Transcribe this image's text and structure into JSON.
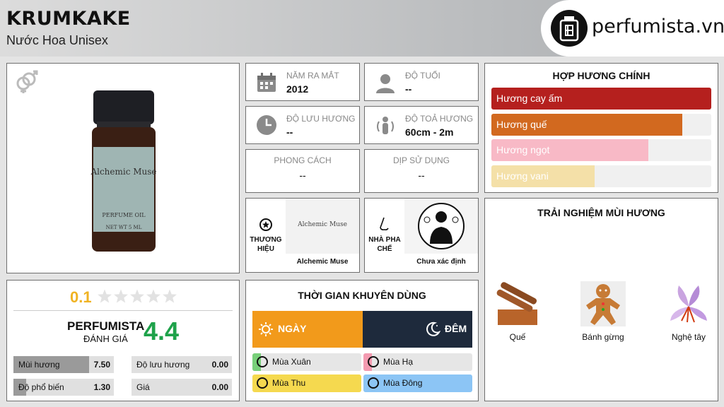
{
  "header": {
    "title": "KRUMKAKE",
    "subtitle": "Nước Hoa Unisex",
    "logo_text": "perfumista.vn"
  },
  "product": {
    "bottle_label_brand": "Alchemic Muse",
    "bottle_label_type": "PERFUME OIL",
    "bottle_label_net": "NET WT 5 ML",
    "gender_icon": "unisex-gender-icon"
  },
  "info": {
    "release": {
      "label": "NĂM RA MẮT",
      "value": "2012",
      "icon": "calendar-icon"
    },
    "age": {
      "label": "ĐỘ TUỔI",
      "value": "--",
      "icon": "person-icon"
    },
    "longevity": {
      "label": "ĐỘ LƯU HƯƠNG",
      "value": "--",
      "icon": "clock-icon"
    },
    "sillage": {
      "label": "ĐỘ TOẢ HƯƠNG",
      "value": "60cm - 2m",
      "icon": "sillage-person-icon"
    },
    "style": {
      "label": "PHONG CÁCH",
      "value": "--"
    },
    "occasion": {
      "label": "DỊP SỬ DỤNG",
      "value": "--"
    },
    "brand": {
      "label_line1": "THƯƠNG",
      "label_line2": "HIỆU",
      "logo_text": "Alchemic Muse",
      "name": "Alchemic Muse"
    },
    "perfumer": {
      "label_line1": "NHÀ PHA",
      "label_line2": "CHẾ",
      "name": "Chưa xác định"
    }
  },
  "accords": {
    "title": "HỢP HƯƠNG CHÍNH",
    "items": [
      {
        "label": "Hương cay ấm",
        "fraction": 1.0,
        "color": "#b5201e"
      },
      {
        "label": "Hương quế",
        "fraction": 0.868,
        "color": "#d2691f"
      },
      {
        "label": "Hương ngọt",
        "fraction": 0.715,
        "color": "#f8b9c6"
      },
      {
        "label": "Hương vani",
        "fraction": 0.47,
        "color": "#f4e0a8"
      }
    ]
  },
  "notes": {
    "title": "TRẢI NGHIỆM MÙI HƯƠNG",
    "items": [
      {
        "label": "Quế"
      },
      {
        "label": "Bánh gừng"
      },
      {
        "label": "Nghệ tây"
      }
    ]
  },
  "rating": {
    "user_score": "0.1",
    "user_stars": 0.02,
    "brand_line1": "PERFUMISTA",
    "brand_line2": "ĐÁNH GIÁ",
    "perfumista_score": "4.4",
    "metrics": [
      {
        "label": "Mùi hương",
        "value": "7.50",
        "fraction": 0.75
      },
      {
        "label": "Độ lưu hương",
        "value": "0.00",
        "fraction": 0.0
      },
      {
        "label": "Độ phổ biến",
        "value": "1.30",
        "fraction": 0.13
      },
      {
        "label": "Giá",
        "value": "0.00",
        "fraction": 0.0
      }
    ]
  },
  "time": {
    "title": "THỜI GIAN KHUYÊN DÙNG",
    "day_label": "NGÀY",
    "night_label": "ĐÊM",
    "day_color": "#f29a1b",
    "night_color": "#1e2a3c",
    "seasons": [
      {
        "label": "Mùa Xuân",
        "color": "#78d07a",
        "icon": "spring-flower-icon"
      },
      {
        "label": "Mùa Hạ",
        "color": "#f39ab0",
        "icon": "summer-sun-icon"
      },
      {
        "label": "Mùa Thu",
        "color": "#f5d94f",
        "icon": "autumn-leaf-icon"
      },
      {
        "label": "Mùa Đông",
        "color": "#8cc5f5",
        "icon": "winter-snowflake-icon"
      }
    ]
  }
}
